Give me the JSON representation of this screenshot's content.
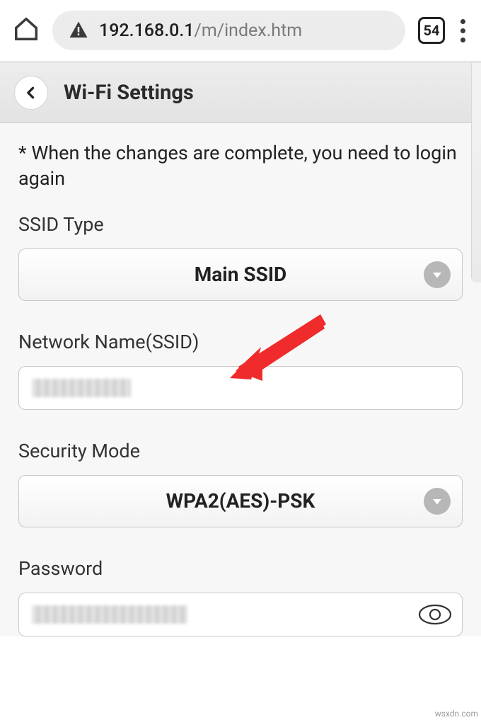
{
  "browser": {
    "url_host": "192.168.0.1",
    "url_path": "/m/index.htm",
    "tab_count": "54"
  },
  "header": {
    "title": "Wi-Fi Settings"
  },
  "content": {
    "notice": "* When the changes are complete, you need to login again",
    "ssid_type_label": "SSID Type",
    "ssid_type_value": "Main SSID",
    "network_name_label": "Network Name(SSID)",
    "network_name_value": "",
    "security_mode_label": "Security Mode",
    "security_mode_value": "WPA2(AES)-PSK",
    "password_label": "Password",
    "password_value": ""
  },
  "watermark": "wsxdn.com"
}
